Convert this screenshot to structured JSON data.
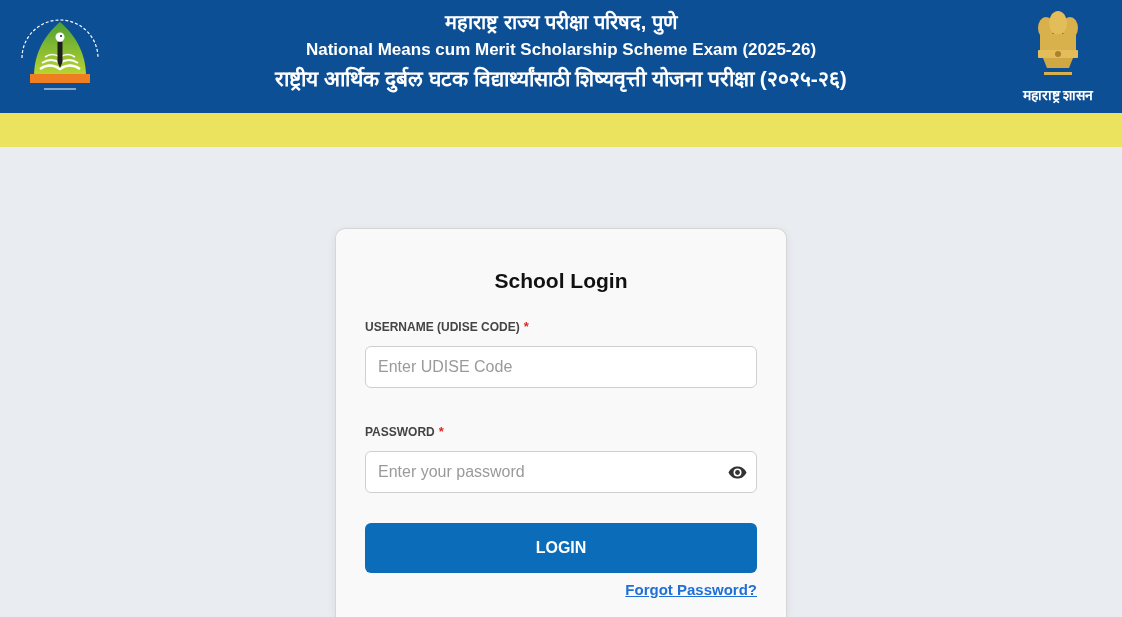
{
  "header": {
    "org_name": "महाराष्ट्र राज्य परीक्षा परिषद, पुणे",
    "exam_name_en": "National Means cum Merit Scholarship Scheme Exam (2025-26)",
    "exam_name_mr": "राष्ट्रीय आर्थिक दुर्बल घटक विद्यार्थ्यांसाठी शिष्यवृत्ती योजना परीक्षा (२०२५-२६)",
    "emblem_caption": "महाराष्ट्र शासन"
  },
  "login_card": {
    "title": "School Login",
    "fields": [
      {
        "kind": "text",
        "label": "USERNAME (UDISE CODE)",
        "required_mark": "*",
        "placeholder": "Enter UDISE Code"
      },
      {
        "kind": "password",
        "label": "PASSWORD",
        "required_mark": "*",
        "placeholder": "Enter your password"
      }
    ],
    "submit_button": "LOGIN",
    "forgot_link": "Forgot Password?"
  }
}
